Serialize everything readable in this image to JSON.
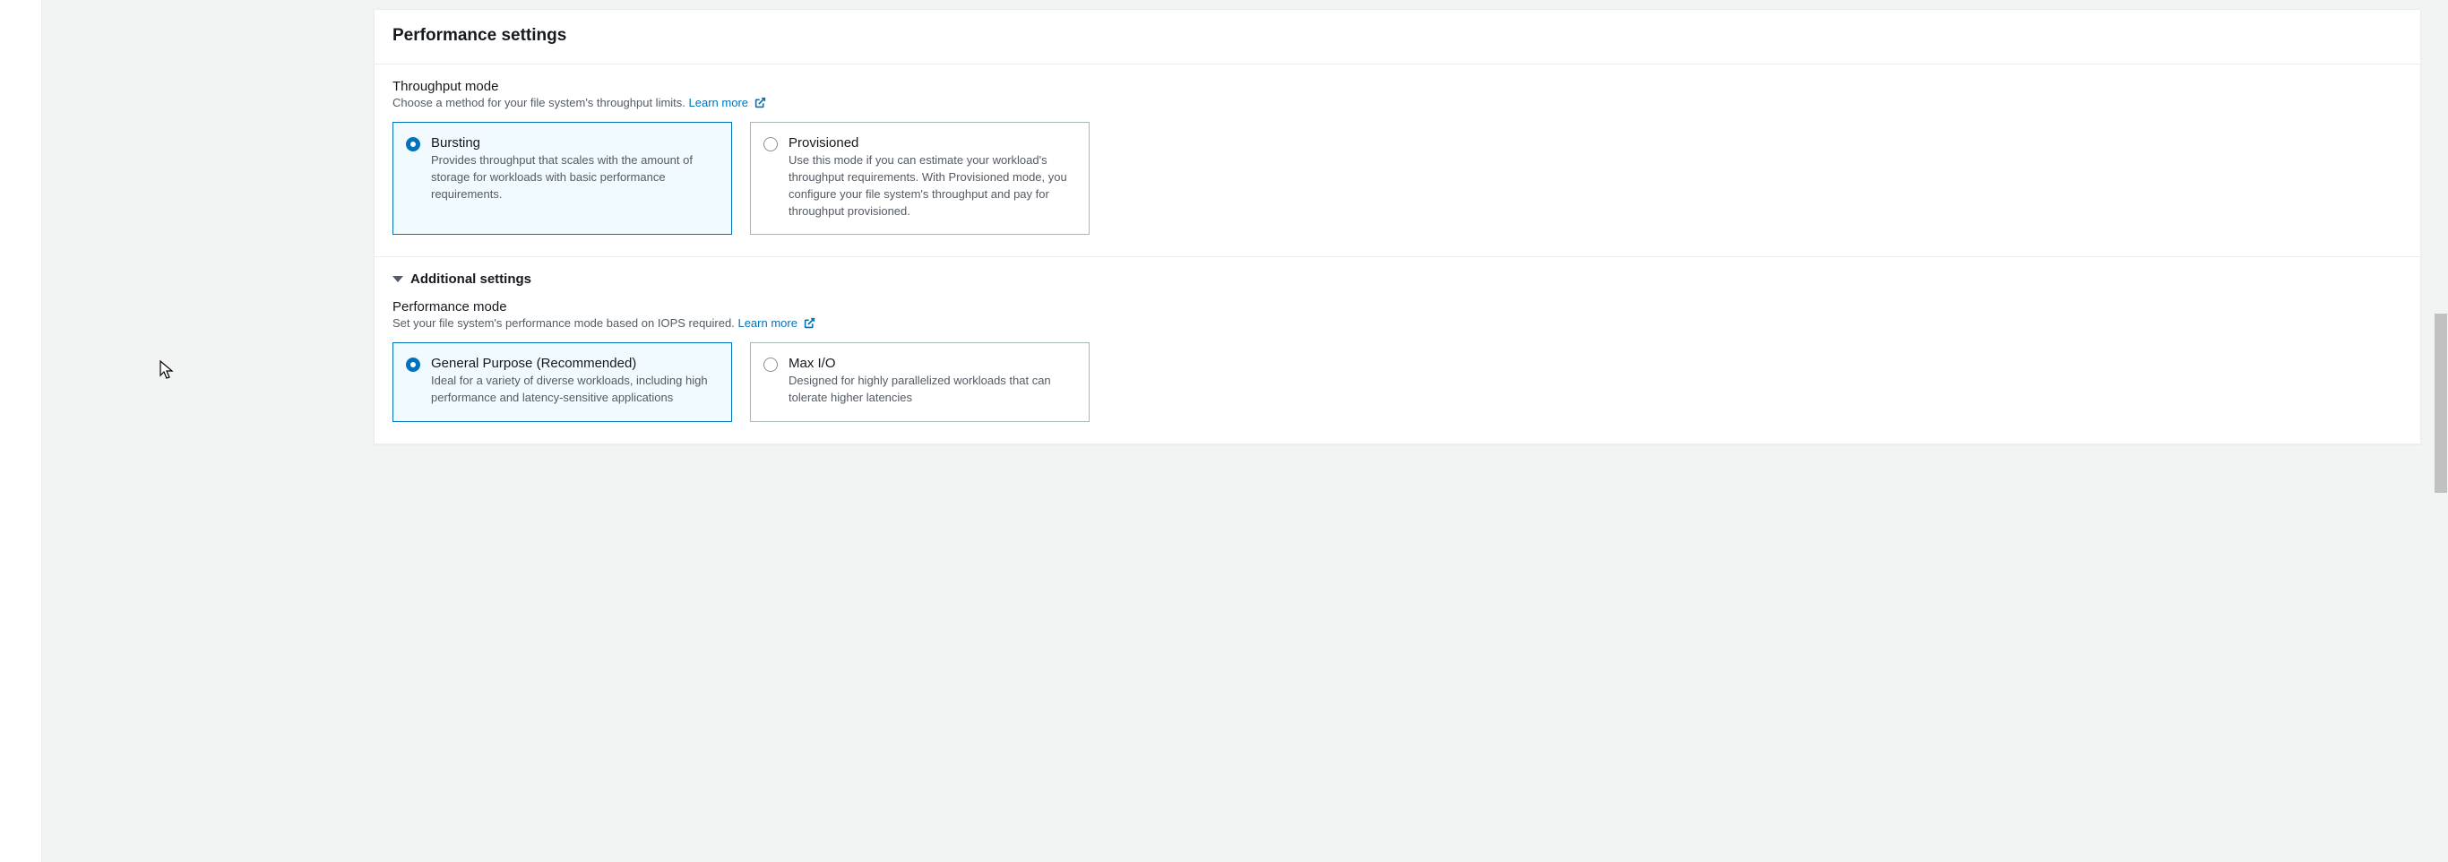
{
  "card": {
    "title": "Performance settings",
    "throughput": {
      "label": "Throughput mode",
      "help": "Choose a method for your file system's throughput limits.",
      "learn_more": "Learn more",
      "options": [
        {
          "title": "Bursting",
          "desc": "Provides throughput that scales with the amount of storage for workloads with basic performance requirements.",
          "selected": true
        },
        {
          "title": "Provisioned",
          "desc": "Use this mode if you can estimate your workload's throughput requirements. With Provisioned mode, you configure your file system's throughput and pay for throughput provisioned.",
          "selected": false
        }
      ]
    },
    "additional": {
      "label": "Additional settings"
    },
    "performance": {
      "label": "Performance mode",
      "help": "Set your file system's performance mode based on IOPS required.",
      "learn_more": "Learn more",
      "options": [
        {
          "title": "General Purpose (Recommended)",
          "desc": "Ideal for a variety of diverse workloads, including high performance and latency-sensitive applications",
          "selected": true
        },
        {
          "title": "Max I/O",
          "desc": "Designed for highly parallelized workloads that can tolerate higher latencies",
          "selected": false
        }
      ]
    }
  }
}
